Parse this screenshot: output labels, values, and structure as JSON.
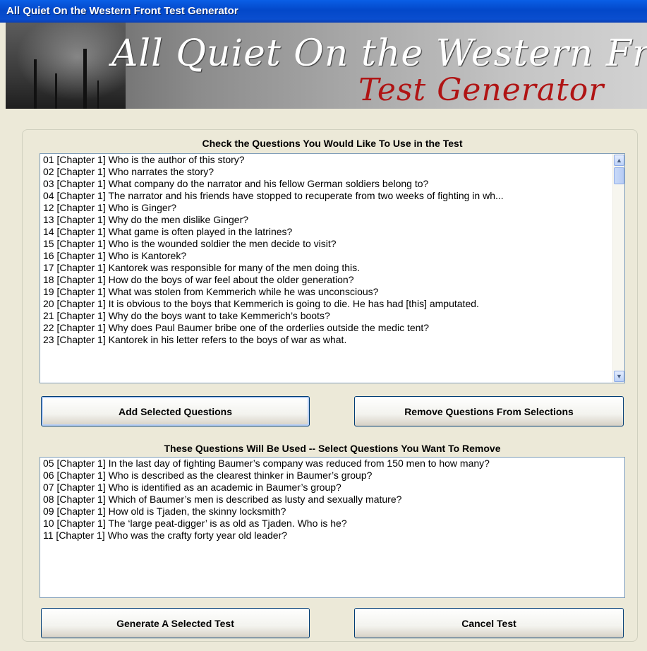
{
  "window": {
    "title": "All Quiet On the Western Front Test Generator"
  },
  "banner": {
    "title_line1": "All Quiet On the Western Front",
    "title_line2": "Test Generator"
  },
  "available": {
    "label": "Check the Questions You Would Like To Use in the Test",
    "items": [
      "01 [Chapter 1] Who is the author of this story?",
      "02 [Chapter 1] Who narrates the story?",
      "03 [Chapter 1] What company do the narrator and his fellow German soldiers belong to?",
      "04 [Chapter 1] The narrator and his friends have stopped to recuperate from two weeks of fighting in wh...",
      "12 [Chapter 1] Who is Ginger?",
      "13 [Chapter 1] Why do the men dislike Ginger?",
      "14 [Chapter 1] What game is often played in the latrines?",
      "15 [Chapter 1] Who is the wounded soldier the men decide to visit?",
      "16 [Chapter 1] Who is Kantorek?",
      "17 [Chapter 1] Kantorek was responsible for many of the men doing this.",
      "18 [Chapter 1] How do the boys of war feel about the older generation?",
      "19 [Chapter 1] What was stolen from Kemmerich while he was unconscious?",
      "20 [Chapter 1] It is obvious to the boys that Kemmerich is going to die.  He has had [this] amputated.",
      "21 [Chapter 1] Why do the boys want to take Kemmerich’s boots?",
      "22 [Chapter 1] Why does Paul Baumer bribe one of the orderlies outside the medic tent?",
      "23 [Chapter 1] Kantorek in his letter refers to the boys of war as what."
    ]
  },
  "selected": {
    "label": "These Questions Will Be Used -- Select Questions You Want To Remove",
    "items": [
      "05 [Chapter 1] In the last day of fighting Baumer’s company was reduced from 150 men to how many?",
      "06 [Chapter 1] Who is described as the clearest thinker in Baumer’s group?",
      "07 [Chapter 1] Who is identified as an academic in Baumer’s group?",
      "08 [Chapter 1] Which of Baumer’s men is described as lusty and sexually mature?",
      "09 [Chapter 1] How old is Tjaden, the skinny locksmith?",
      "10 [Chapter 1] The ‘large peat-digger’ is as old as Tjaden.  Who is he?",
      "11 [Chapter 1] Who was the crafty forty year old leader?"
    ]
  },
  "buttons": {
    "add": "Add Selected Questions",
    "remove": "Remove Questions From Selections",
    "generate": "Generate A Selected Test",
    "cancel": "Cancel Test"
  },
  "scrollbar": {
    "up_glyph": "▲",
    "down_glyph": "▼"
  }
}
